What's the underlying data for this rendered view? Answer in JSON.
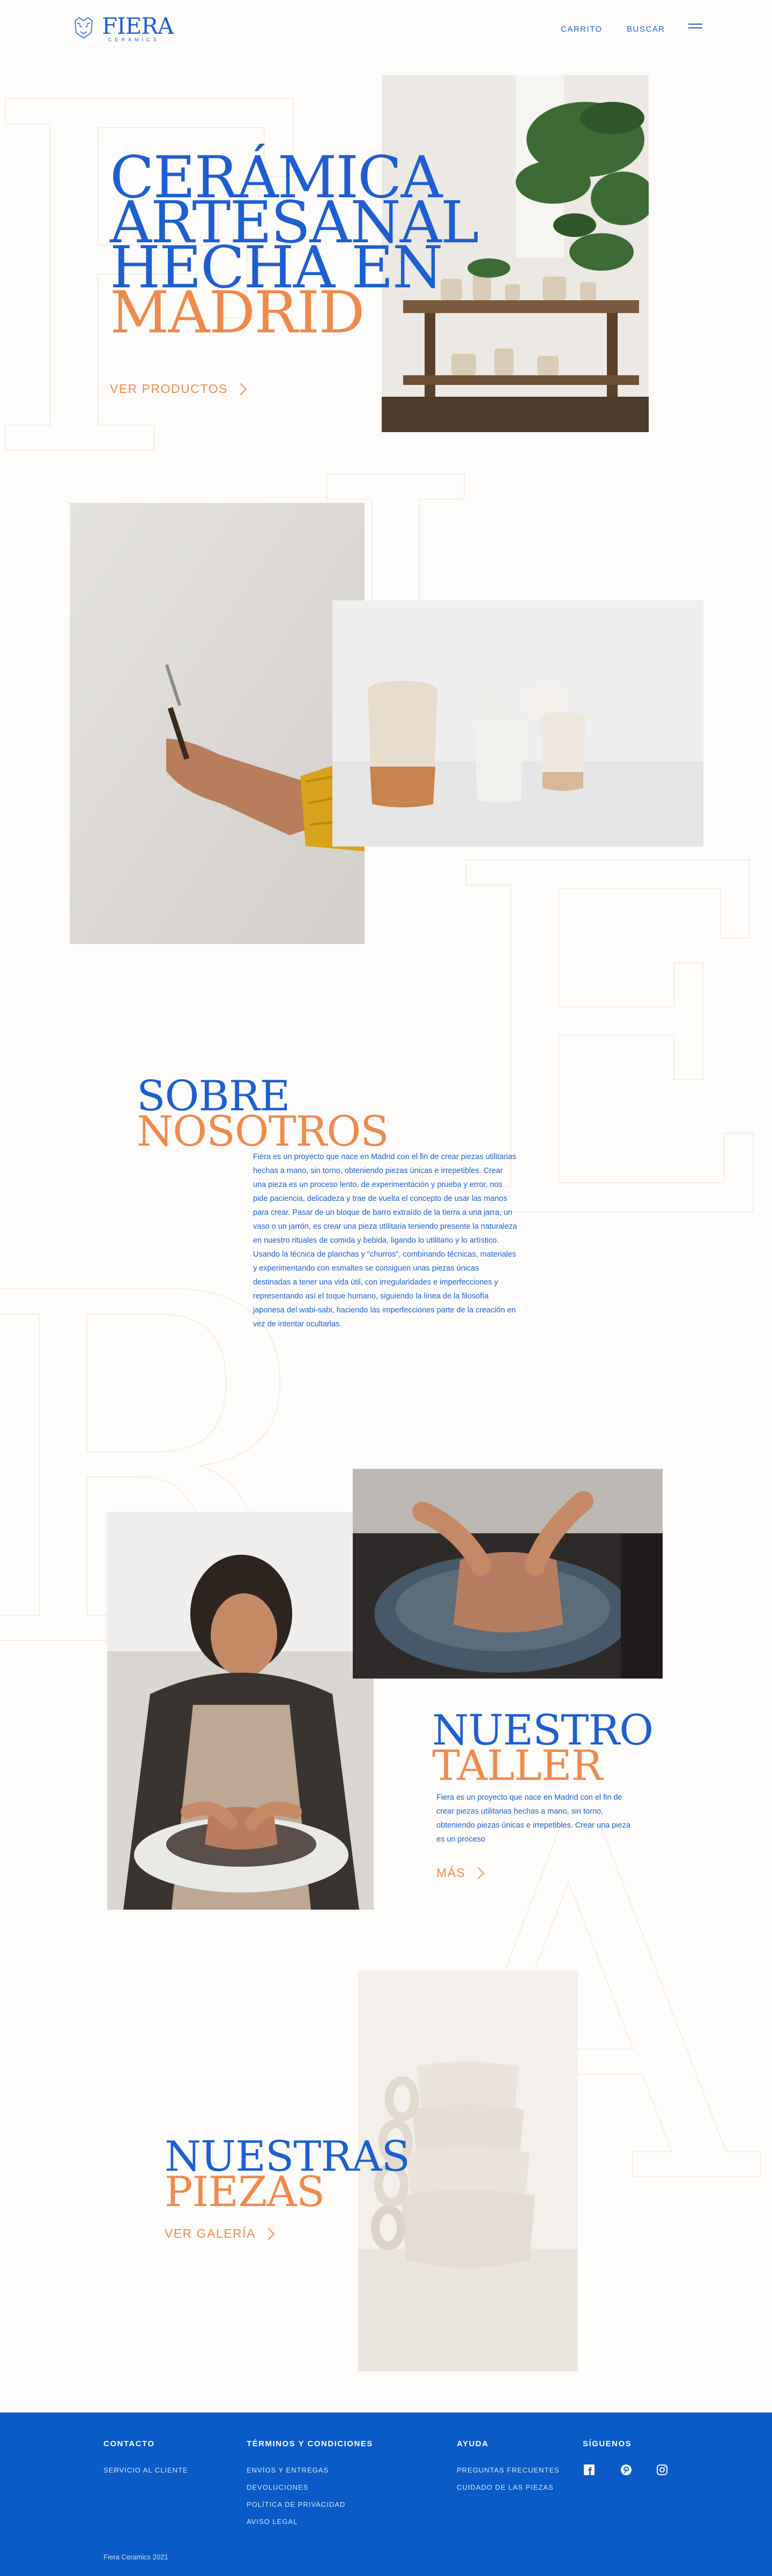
{
  "brand": {
    "name": "FIERA",
    "tagline": "CERAMICS",
    "primary_color": "#1d5fd2",
    "accent_color": "#f08a4b"
  },
  "nav": {
    "cart_label": "CARRITO",
    "search_label": "BUSCAR",
    "menu_icon": "hamburger-icon"
  },
  "hero": {
    "title_lines": [
      "CERÁMICA",
      "ARTESANAL",
      "HECHA EN"
    ],
    "title_highlight": "MADRID",
    "cta_label": "VER PRODUCTOS"
  },
  "about": {
    "title_line1": "SOBRE",
    "title_line2": "NOSOTROS",
    "text": "Fiera es un proyecto que nace en Madrid con el fin de crear piezas utilitarias hechas a mano, sin torno, obteniendo piezas únicas e irrepetibles. Crear una pieza es un proceso lento, de experimentación y prueba y error, nos pide paciencia, delicadeza y trae de vuelta el concepto de usar las manos para crear. Pasar de un bloque de barro extraído de la tierra a una jarra, un vaso o un jarrón, es crear una pieza utilitaria teniendo presente la naturaleza en nuestro rituales de comida y bebida, ligando lo utilitario y lo artístico. Usando la técnica de planchas y \"churros\", combinando técnicas, materiales y experimentando con esmaltes se consiguen unas piezas únicas destinadas a tener una vida útil, con irregularidades e imperfecciones y representando así el toque humano, siguiendo la línea de la filosofía japonesa del wabi-sabi, haciendo las imperfecciones parte de la creación en vez de intentar ocultarlas."
  },
  "workshop": {
    "title_line1": "NUESTRO",
    "title_line2": "TALLER",
    "text": "Fiera es un proyecto que nace en Madrid con el fin de crear piezas utilitarias hechas a mano, sin torno, obteniendo piezas únicas e irrepetibles. Crear una pieza es un proceso",
    "cta_label": "MÁS"
  },
  "pieces": {
    "title_line1": "NUESTRAS",
    "title_line2": "PIEZAS",
    "cta_label": "VER GALERÍA"
  },
  "footer": {
    "contact": {
      "heading": "CONTACTO",
      "links": [
        "SERVICIO AL CLIENTE"
      ]
    },
    "terms": {
      "heading": "TÉRMINOS Y CONDICIONES",
      "links": [
        "ENVÍOS Y ENTREGAS",
        "DEVOLUCIONES",
        "POLÍTICA DE PRIVACIDAD",
        "AVISO LEGAL"
      ]
    },
    "help": {
      "heading": "AYUDA",
      "links": [
        "PREGUNTAS FRECUENTES",
        "CUIDADO DE LAS PIEZAS"
      ]
    },
    "follow": {
      "heading": "SÍGUENOS",
      "icons": [
        "facebook-icon",
        "pinterest-icon",
        "instagram-icon"
      ]
    },
    "copyright": "Fiera Ceramics 2021"
  }
}
